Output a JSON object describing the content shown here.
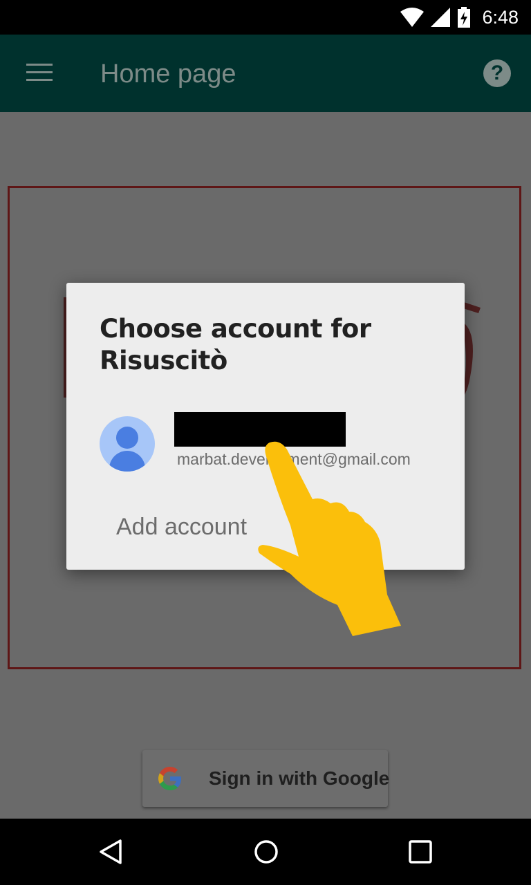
{
  "status_bar": {
    "time": "6:48",
    "icons": [
      "wifi-icon",
      "signal-icon",
      "battery-charging-icon"
    ]
  },
  "toolbar": {
    "title": "Home page",
    "menu_icon": "menu-icon",
    "help_icon": "help-icon",
    "help_glyph": "?"
  },
  "signin": {
    "label": "Sign in with Google"
  },
  "dialog": {
    "title": "Choose account for Risuscitò",
    "account": {
      "email": "marbat.development@gmail.com",
      "name_redacted": true
    },
    "add_account": "Add account"
  },
  "colors": {
    "toolbar": "#00312d",
    "scrim": "#6a6a6a",
    "dialog": "#ededed",
    "pointer_hand": "#fbbf0b",
    "frame": "#5e1616"
  },
  "nav_bar": {
    "buttons": [
      "back-icon",
      "home-icon",
      "recents-icon"
    ]
  }
}
